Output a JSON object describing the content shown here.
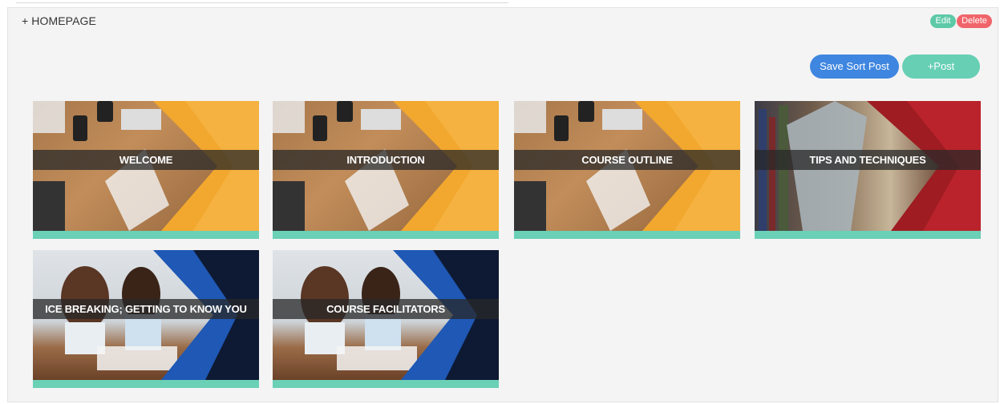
{
  "section": {
    "title": "+ HOMEPAGE"
  },
  "actions": {
    "edit_label": "Edit",
    "delete_label": "Delete"
  },
  "toolbar": {
    "save_sort_label": "Save Sort Post",
    "post_label": "+Post"
  },
  "colors": {
    "accent_blue": "#3f86e0",
    "accent_green": "#66cfb4",
    "delete_red": "#f0656b",
    "card_strip": "#6ad0b6"
  },
  "posts": [
    {
      "title": "WELCOME",
      "theme": "orange"
    },
    {
      "title": "INTRODUCTION",
      "theme": "orange"
    },
    {
      "title": "COURSE OUTLINE",
      "theme": "orange"
    },
    {
      "title": "TIPS AND TECHNIQUES",
      "theme": "red"
    },
    {
      "title": "ICE BREAKING; GETTING TO KNOW YOU",
      "theme": "blue"
    },
    {
      "title": "COURSE FACILITATORS",
      "theme": "blue"
    }
  ]
}
